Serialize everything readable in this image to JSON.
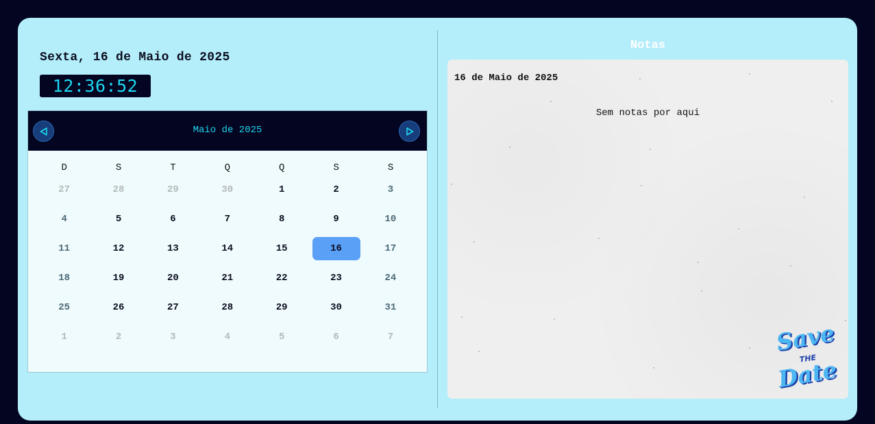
{
  "header": {
    "date_title": "Sexta, 16 de Maio de 2025",
    "clock": "12:36:52"
  },
  "calendar": {
    "month_title": "Maio de 2025",
    "prev_icon": "triangle-left-icon",
    "next_icon": "triangle-right-icon",
    "weekdays": [
      "D",
      "S",
      "T",
      "Q",
      "Q",
      "S",
      "S"
    ],
    "weeks": [
      [
        {
          "d": "27",
          "t": "other"
        },
        {
          "d": "28",
          "t": "other"
        },
        {
          "d": "29",
          "t": "other"
        },
        {
          "d": "30",
          "t": "other"
        },
        {
          "d": "1",
          "t": "day"
        },
        {
          "d": "2",
          "t": "day"
        },
        {
          "d": "3",
          "t": "weekend"
        }
      ],
      [
        {
          "d": "4",
          "t": "weekend"
        },
        {
          "d": "5",
          "t": "day"
        },
        {
          "d": "6",
          "t": "day"
        },
        {
          "d": "7",
          "t": "day"
        },
        {
          "d": "8",
          "t": "day"
        },
        {
          "d": "9",
          "t": "day"
        },
        {
          "d": "10",
          "t": "weekend"
        }
      ],
      [
        {
          "d": "11",
          "t": "weekend"
        },
        {
          "d": "12",
          "t": "day"
        },
        {
          "d": "13",
          "t": "day"
        },
        {
          "d": "14",
          "t": "day"
        },
        {
          "d": "15",
          "t": "day"
        },
        {
          "d": "16",
          "t": "selected"
        },
        {
          "d": "17",
          "t": "weekend"
        }
      ],
      [
        {
          "d": "18",
          "t": "weekend"
        },
        {
          "d": "19",
          "t": "day"
        },
        {
          "d": "20",
          "t": "day"
        },
        {
          "d": "21",
          "t": "day"
        },
        {
          "d": "22",
          "t": "day"
        },
        {
          "d": "23",
          "t": "day"
        },
        {
          "d": "24",
          "t": "weekend"
        }
      ],
      [
        {
          "d": "25",
          "t": "weekend"
        },
        {
          "d": "26",
          "t": "day"
        },
        {
          "d": "27",
          "t": "day"
        },
        {
          "d": "28",
          "t": "day"
        },
        {
          "d": "29",
          "t": "day"
        },
        {
          "d": "30",
          "t": "day"
        },
        {
          "d": "31",
          "t": "weekend"
        }
      ],
      [
        {
          "d": "1",
          "t": "other"
        },
        {
          "d": "2",
          "t": "other"
        },
        {
          "d": "3",
          "t": "other"
        },
        {
          "d": "4",
          "t": "other"
        },
        {
          "d": "5",
          "t": "other"
        },
        {
          "d": "6",
          "t": "other"
        },
        {
          "d": "7",
          "t": "other"
        }
      ]
    ]
  },
  "notes": {
    "title": "Notas",
    "date": "16 de Maio de 2025",
    "empty_message": "Sem notas por aqui",
    "logo": {
      "lines": [
        "Save",
        "THE",
        "Date"
      ],
      "icon": "save-the-date-logo"
    }
  },
  "colors": {
    "background": "#030521",
    "panel": "#b4eefa",
    "accent": "#1fd6ef",
    "selected_day": "#5aa0f7"
  }
}
